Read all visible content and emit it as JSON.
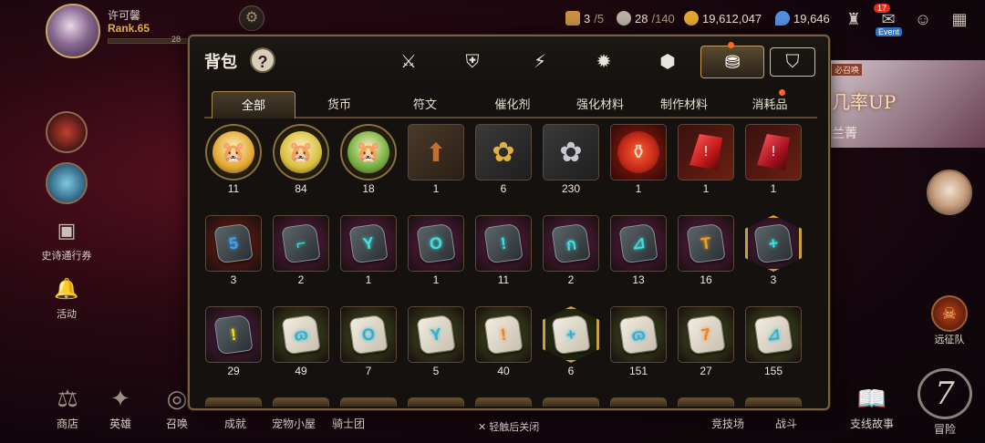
{
  "player": {
    "name": "许可馨",
    "rank": "Rank.65",
    "level": "28"
  },
  "resources": [
    {
      "name": "stamina",
      "value": "3",
      "max": "/5",
      "color": "#c89040"
    },
    {
      "name": "energy",
      "value": "28",
      "max": "/140",
      "color": "#b8b0a0"
    },
    {
      "name": "gold",
      "value": "19,612,047",
      "max": "",
      "color": "#e0a830"
    },
    {
      "name": "crystal",
      "value": "19,646",
      "max": "",
      "color": "#5090e0"
    }
  ],
  "top_right": {
    "event_count": "17",
    "event_label": "Event"
  },
  "left_menu": [
    {
      "label": "史诗通行券"
    },
    {
      "label": "活动"
    }
  ],
  "banner": {
    "tag": "必召唤",
    "title": "几率UP",
    "subtitle": "兰菁"
  },
  "expedition": {
    "label": "远征队"
  },
  "bottom_nav": [
    {
      "label": "商店"
    },
    {
      "label": "英雄"
    },
    {
      "label": "召唤"
    },
    {
      "label": "成就"
    },
    {
      "label": "宠物小屋"
    },
    {
      "label": "骑士团"
    },
    {
      "label": "竞技场"
    },
    {
      "label": "战斗"
    },
    {
      "label": "支线故事"
    },
    {
      "label": "冒险"
    }
  ],
  "close_hint": "轻触后关闭",
  "dialog": {
    "title": "背包",
    "help": "?",
    "categories": [
      {
        "icon": "equipment-icon"
      },
      {
        "icon": "artifact-icon"
      },
      {
        "icon": "lightning-icon"
      },
      {
        "icon": "imprint-icon"
      },
      {
        "icon": "cube-icon"
      },
      {
        "icon": "bag-icon",
        "active": true
      },
      {
        "icon": "shield-box-icon"
      }
    ],
    "tabs": [
      "全部",
      "货币",
      "符文",
      "催化剂",
      "强化材料",
      "制作材料",
      "消耗品"
    ],
    "active_tab": "全部",
    "items": [
      {
        "qty": "11",
        "type": "hamster",
        "color": "#e0a830"
      },
      {
        "qty": "84",
        "type": "hamster",
        "color": "#d8c040"
      },
      {
        "qty": "18",
        "type": "hamster",
        "color": "#70b040"
      },
      {
        "qty": "1",
        "type": "box",
        "color": "#c07030"
      },
      {
        "qty": "6",
        "type": "flower",
        "color": "#e0b040"
      },
      {
        "qty": "230",
        "type": "flower",
        "color": "#c8c8d0"
      },
      {
        "qty": "1",
        "type": "potion",
        "color": "#c02818"
      },
      {
        "qty": "1",
        "type": "gem",
        "color": "#c01818"
      },
      {
        "qty": "1",
        "type": "gem",
        "color": "#a81020"
      },
      {
        "qty": "3",
        "type": "rune-dark",
        "glyph": "5",
        "color": "#40a0f0",
        "bg": "#802010"
      },
      {
        "qty": "2",
        "type": "rune-dark",
        "glyph": "⌐",
        "color": "#40e0e0",
        "bg": "#6a2050"
      },
      {
        "qty": "1",
        "type": "rune-dark",
        "glyph": "Y",
        "color": "#40e0e0",
        "bg": "#6a2050"
      },
      {
        "qty": "1",
        "type": "rune-dark",
        "glyph": "O",
        "color": "#40e0e0",
        "bg": "#6a2050"
      },
      {
        "qty": "11",
        "type": "rune-dark",
        "glyph": "!",
        "color": "#40e0e0",
        "bg": "#6a2050"
      },
      {
        "qty": "2",
        "type": "rune-dark",
        "glyph": "ก",
        "color": "#40e0e0",
        "bg": "#6a2050"
      },
      {
        "qty": "13",
        "type": "rune-dark",
        "glyph": "⊿",
        "color": "#40e0e0",
        "bg": "#6a2050"
      },
      {
        "qty": "16",
        "type": "rune-dark",
        "glyph": "T",
        "color": "#f0a020",
        "bg": "#6a2050"
      },
      {
        "qty": "3",
        "type": "rune-dark-hex",
        "glyph": "+",
        "color": "#40e0e0",
        "bg": "#5a2060"
      },
      {
        "qty": "29",
        "type": "rune-dark",
        "glyph": "!",
        "color": "#f0e020",
        "bg": "#5a2050"
      },
      {
        "qty": "49",
        "type": "rune-light",
        "glyph": "ɷ",
        "color": "#30b0d0",
        "bg": "#4a6020"
      },
      {
        "qty": "7",
        "type": "rune-light",
        "glyph": "O",
        "color": "#30b0d0",
        "bg": "#4a6020"
      },
      {
        "qty": "5",
        "type": "rune-light",
        "glyph": "Y",
        "color": "#30b0d0",
        "bg": "#4a6020"
      },
      {
        "qty": "40",
        "type": "rune-light",
        "glyph": "!",
        "color": "#f08020",
        "bg": "#4a6020"
      },
      {
        "qty": "6",
        "type": "rune-light-hex",
        "glyph": "+",
        "color": "#30b0d0",
        "bg": "#2a4a20"
      },
      {
        "qty": "151",
        "type": "rune-light",
        "glyph": "ɷ",
        "color": "#30b0d0",
        "bg": "#4a6020"
      },
      {
        "qty": "27",
        "type": "rune-light",
        "glyph": "7",
        "color": "#f08020",
        "bg": "#4a6020"
      },
      {
        "qty": "155",
        "type": "rune-light",
        "glyph": "⊿",
        "color": "#30b0d0",
        "bg": "#4a6020"
      }
    ],
    "partial_row_count": 9
  }
}
